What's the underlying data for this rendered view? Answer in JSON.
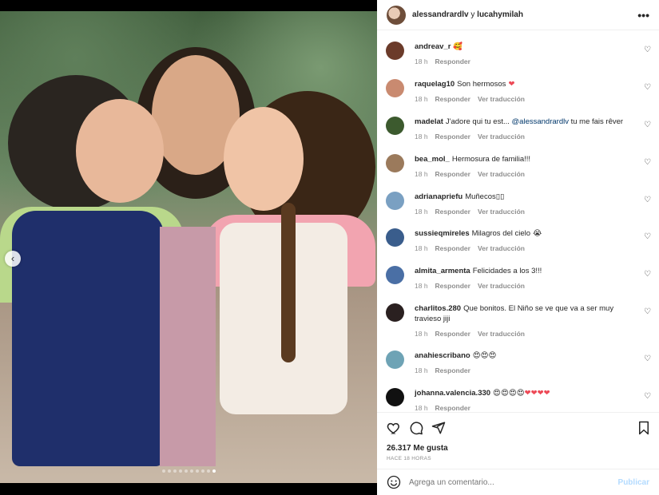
{
  "post": {
    "authors": {
      "primary": "alessandrardlv",
      "connector": "y",
      "secondary": "lucahymilah"
    },
    "more_label": "•••",
    "likes": "26.317 Me gusta",
    "time_ago": "HACE 18 HORAS",
    "carousel": {
      "dots_total": 10,
      "active_index": 9
    }
  },
  "comments": [
    {
      "user": "andreav_r",
      "text": "",
      "emoji": [
        "🥰"
      ],
      "time": "18 h",
      "reply": "Responder",
      "translate": ""
    },
    {
      "user": "raquelag10",
      "text": "Son hermosos",
      "emoji": [
        "❤"
      ],
      "time": "18 h",
      "reply": "Responder",
      "translate": "Ver traducción"
    },
    {
      "user": "madelat",
      "text": "J'adore qui tu est... ",
      "mention": "@alessandrardlv",
      "text_after": " tu me fais rêver",
      "time": "18 h",
      "reply": "Responder",
      "translate": "Ver traducción"
    },
    {
      "user": "bea_mol_",
      "text": "Hermosura de familia!!!",
      "time": "18 h",
      "reply": "Responder",
      "translate": "Ver traducción"
    },
    {
      "user": "adrianapriefu",
      "text": "Muñecos▯▯",
      "time": "18 h",
      "reply": "Responder",
      "translate": "Ver traducción"
    },
    {
      "user": "sussieqmireles",
      "text": "Milagros del cielo",
      "emoji": [
        "😭"
      ],
      "time": "18 h",
      "reply": "Responder",
      "translate": "Ver traducción"
    },
    {
      "user": "almita_armenta",
      "text": "Felicidades a los 3!!!",
      "time": "18 h",
      "reply": "Responder",
      "translate": "Ver traducción"
    },
    {
      "user": "charlitos.280",
      "text": "Que bonitos. El Niño se ve que va a ser muy travieso jiji",
      "time": "18 h",
      "reply": "Responder",
      "translate": "Ver traducción"
    },
    {
      "user": "anahiescribano",
      "text": "",
      "emoji": [
        "😍",
        "😍",
        "😍"
      ],
      "time": "18 h",
      "reply": "Responder",
      "translate": ""
    },
    {
      "user": "johanna.valencia.330",
      "text": "",
      "emoji": [
        "😍",
        "😍",
        "😍",
        "😍",
        "❤",
        "❤",
        "❤",
        "❤"
      ],
      "time": "18 h",
      "reply": "Responder",
      "translate": ""
    }
  ],
  "add_comment": {
    "placeholder": "Agrega un comentario...",
    "publish": "Publicar"
  },
  "colors": {
    "link": "#00376b",
    "muted": "#8e8e8e",
    "publish": "#b3dbff",
    "heart": "#ed4956"
  }
}
